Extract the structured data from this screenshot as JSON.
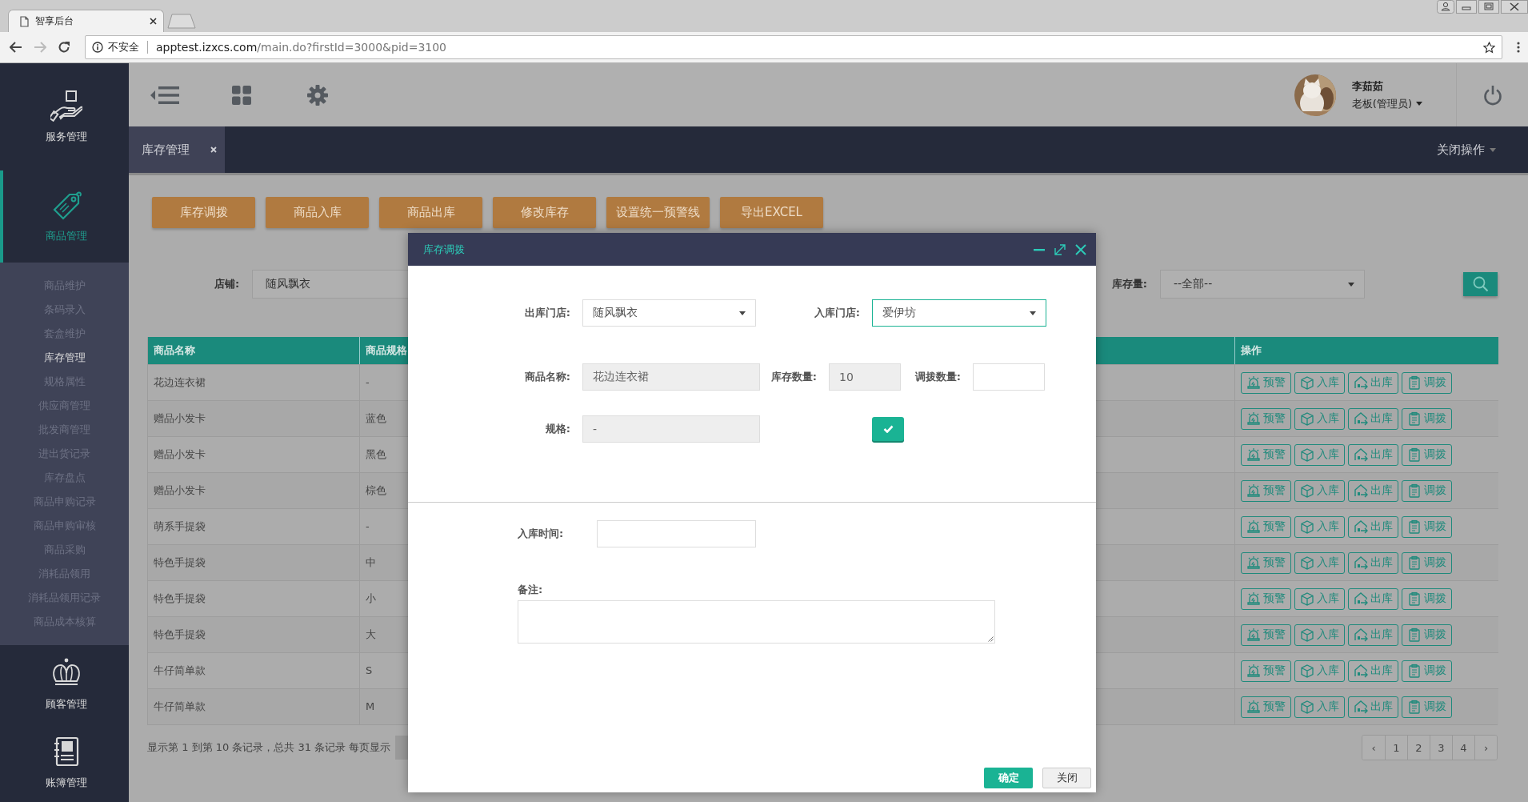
{
  "browser": {
    "tabs": [
      {
        "title": "智享后台",
        "selected": true
      }
    ],
    "security_label": "不安全",
    "url_host": "apptest.izxcs.com",
    "url_path": "/main.do?firstId=3000&pid=3100"
  },
  "sidebar": {
    "sections": [
      {
        "label": "服务管理",
        "selected": false
      },
      {
        "label": "商品管理",
        "selected": true,
        "children": [
          {
            "label": "商品维护",
            "selected": false
          },
          {
            "label": "条码录入",
            "selected": false
          },
          {
            "label": "套盒维护",
            "selected": false
          },
          {
            "label": "库存管理",
            "selected": true
          },
          {
            "label": "规格属性",
            "selected": false
          },
          {
            "label": "供应商管理",
            "selected": false
          },
          {
            "label": "批发商管理",
            "selected": false
          },
          {
            "label": "进出货记录",
            "selected": false
          },
          {
            "label": "库存盘点",
            "selected": false
          },
          {
            "label": "商品申购记录",
            "selected": false
          },
          {
            "label": "商品申购审核",
            "selected": false
          },
          {
            "label": "商品采购",
            "selected": false
          },
          {
            "label": "消耗品领用",
            "selected": false
          },
          {
            "label": "消耗品领用记录",
            "selected": false
          },
          {
            "label": "商品成本核算",
            "selected": false
          }
        ]
      },
      {
        "label": "顾客管理",
        "selected": false
      },
      {
        "label": "账簿管理",
        "selected": false
      }
    ]
  },
  "header": {
    "user": {
      "name": "李茹茹",
      "role": "老板(管理员)"
    }
  },
  "page_tabs": [
    {
      "label": "库存管理",
      "selected": true
    }
  ],
  "close_operations": "关闭操作",
  "toolbar": [
    "库存调拨",
    "商品入库",
    "商品出库",
    "修改库存",
    "设置统一预警线",
    "导出EXCEL"
  ],
  "filters": [
    {
      "label": "店铺:",
      "value": "随风飘衣"
    },
    {
      "label": "库存量:",
      "value": "--全部--"
    }
  ],
  "table": {
    "columns": [
      "商品名称",
      "商品规格",
      "操作"
    ],
    "rows": [
      {
        "cells": [
          "花边连衣裙",
          "-"
        ],
        "actions": [
          "预警",
          "入库",
          "出库",
          "调拨"
        ]
      },
      {
        "cells": [
          "赠品小发卡",
          "蓝色"
        ],
        "actions": [
          "预警",
          "入库",
          "出库",
          "调拨"
        ]
      },
      {
        "cells": [
          "赠品小发卡",
          "黑色"
        ],
        "actions": [
          "预警",
          "入库",
          "出库",
          "调拨"
        ]
      },
      {
        "cells": [
          "赠品小发卡",
          "棕色"
        ],
        "actions": [
          "预警",
          "入库",
          "出库",
          "调拨"
        ]
      },
      {
        "cells": [
          "萌系手提袋",
          "-"
        ],
        "actions": [
          "预警",
          "入库",
          "出库",
          "调拨"
        ]
      },
      {
        "cells": [
          "特色手提袋",
          "中"
        ],
        "actions": [
          "预警",
          "入库",
          "出库",
          "调拨"
        ]
      },
      {
        "cells": [
          "特色手提袋",
          "小"
        ],
        "actions": [
          "预警",
          "入库",
          "出库",
          "调拨"
        ]
      },
      {
        "cells": [
          "特色手提袋",
          "大"
        ],
        "actions": [
          "预警",
          "入库",
          "出库",
          "调拨"
        ]
      },
      {
        "cells": [
          "牛仔简单款",
          "S"
        ],
        "actions": [
          "预警",
          "入库",
          "出库",
          "调拨"
        ]
      },
      {
        "cells": [
          "牛仔简单款",
          "M"
        ],
        "actions": [
          "预警",
          "入库",
          "出库",
          "调拨"
        ]
      }
    ]
  },
  "pagination": {
    "summary": "显示第 1 到第 10 条记录，总共 31 条记录 每页显示",
    "prev": "‹",
    "pages": [
      {
        "label": "1",
        "selected": false
      },
      {
        "label": "2",
        "selected": false
      },
      {
        "label": "3",
        "selected": false
      },
      {
        "label": "4",
        "selected": false
      }
    ],
    "next": "›"
  },
  "dialog": {
    "title": "库存调拨",
    "rows": [
      [
        {
          "kind": "select",
          "label": "出库门店:",
          "value": "随风飘衣",
          "focused": false
        },
        {
          "kind": "select",
          "label": "入库门店:",
          "value": "爱伊坊",
          "focused": true
        }
      ],
      [
        {
          "kind": "readonly",
          "label": "商品名称:",
          "value": "花边连衣裙"
        },
        {
          "kind": "readonly",
          "label": "库存数量:",
          "value": "10"
        },
        {
          "kind": "input",
          "label": "调拨数量:"
        }
      ],
      [
        {
          "kind": "readonly",
          "label": "规格:",
          "value": "-"
        },
        {
          "kind": "confirm"
        }
      ]
    ],
    "time_label": "入库时间:",
    "note_label": "备注:",
    "buttons": [
      {
        "kind": "primary",
        "label": "确定"
      },
      {
        "kind": "default",
        "label": "关闭"
      }
    ]
  }
}
